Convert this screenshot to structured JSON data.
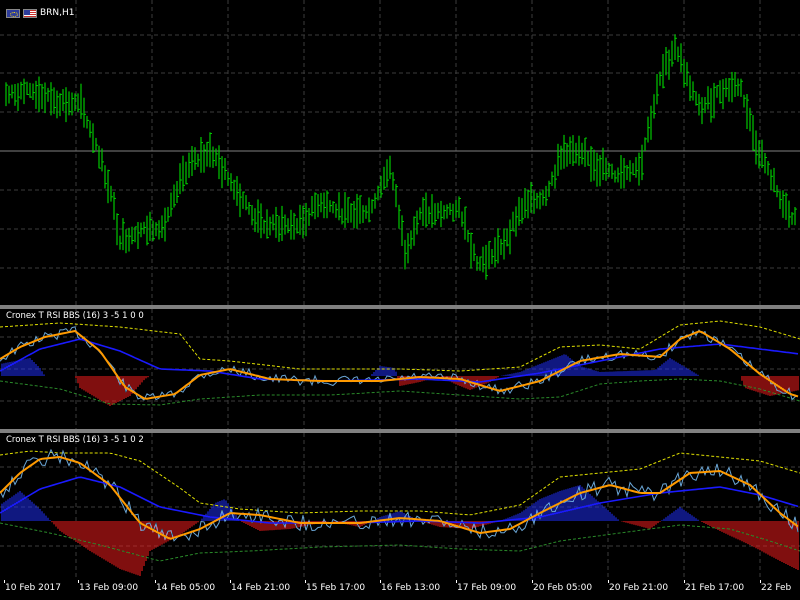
{
  "symbol": {
    "label": "BRN,H1"
  },
  "indicators": [
    {
      "label": "Cronex T RSI BBS (16) 3 -5 1 0 0"
    },
    {
      "label": "Cronex T RSI BBS (16) 3 -5 1 0 2"
    }
  ],
  "time_axis": [
    "10 Feb 2017",
    "13 Feb 09:00",
    "14 Feb 05:00",
    "14 Feb 21:00",
    "15 Feb 17:00",
    "16 Feb 13:00",
    "17 Feb 09:00",
    "20 Feb 05:00",
    "20 Feb 21:00",
    "21 Feb 17:00",
    "22 Feb"
  ],
  "colors": {
    "background": "#000000",
    "grid": "#3c3c3c",
    "bull": "#00c800",
    "histo_up": "#2030ff",
    "histo_down": "#ff1e1e",
    "fast": "#ff9a00",
    "slow": "#1a1aff",
    "raw": "#6aa6d6",
    "band_upper": "#e0e000",
    "band_lower": "#2a8a2a"
  },
  "icons": [
    "eu-flag-icon",
    "us-flag-icon"
  ]
}
